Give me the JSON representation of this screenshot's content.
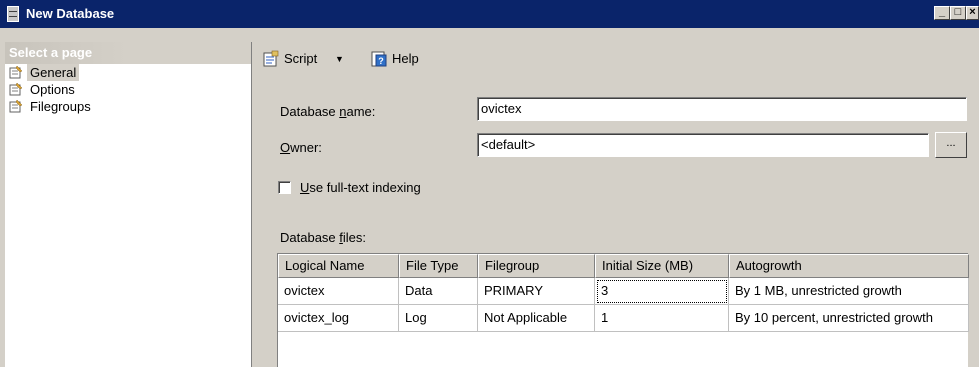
{
  "window": {
    "title": "New Database"
  },
  "left_panel": {
    "header": "Select a page",
    "pages": [
      {
        "label": "General",
        "selected": true
      },
      {
        "label": "Options",
        "selected": false
      },
      {
        "label": "Filegroups",
        "selected": false
      }
    ]
  },
  "toolbar": {
    "script_label": "Script",
    "help_label": "Help"
  },
  "general": {
    "db_name_label_pre": "Database ",
    "db_name_label_ul": "n",
    "db_name_label_post": "ame:",
    "db_name_value": "ovictex",
    "owner_label_ul": "O",
    "owner_label_post": "wner:",
    "owner_value": "<default>",
    "owner_browse_label": "...",
    "fulltext_label_ul": "U",
    "fulltext_label_post": "se full-text indexing",
    "fulltext_checked": false,
    "files_label_pre": "Database ",
    "files_label_ul": "f",
    "files_label_post": "iles:"
  },
  "files_grid": {
    "columns": [
      "Logical Name",
      "File Type",
      "Filegroup",
      "Initial Size (MB)",
      "Autogrowth"
    ],
    "rows": [
      [
        "ovictex",
        "Data",
        "PRIMARY",
        "3",
        "By 1 MB, unrestricted growth"
      ],
      [
        "ovictex_log",
        "Log",
        "Not Applicable",
        "1",
        "By 10 percent, unrestricted growth"
      ]
    ]
  },
  "colors": {
    "title_bar": "#0a246a",
    "dialog_bg": "#d4d0c8"
  }
}
